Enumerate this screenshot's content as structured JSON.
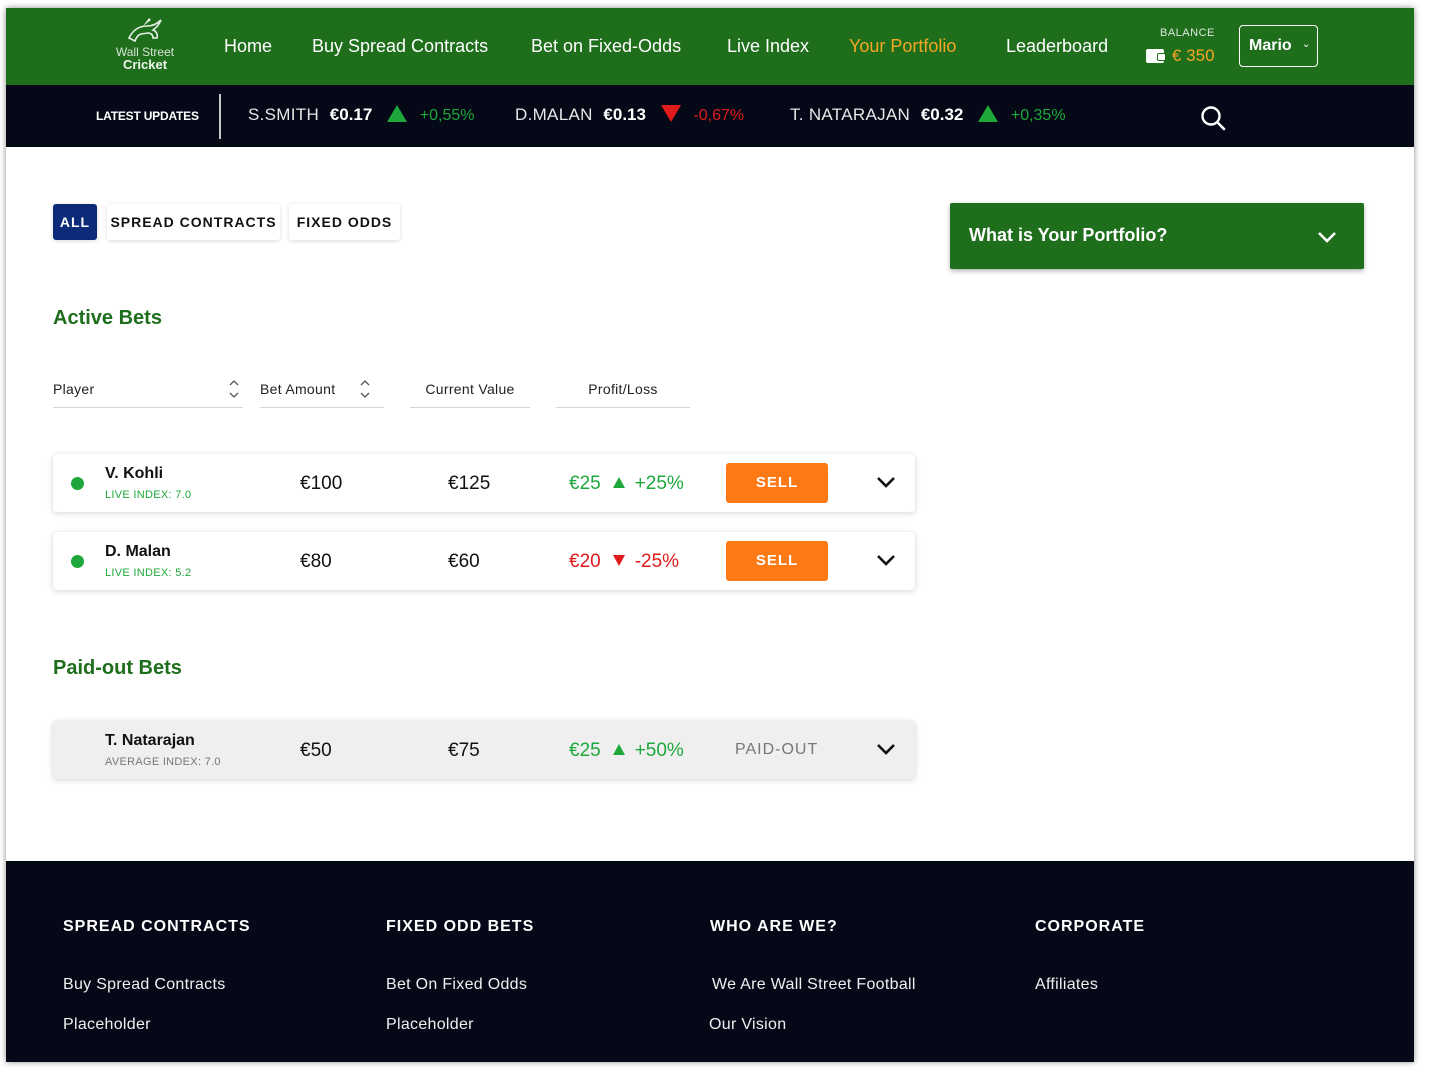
{
  "brand": {
    "line1": "Wall Street",
    "line2": "Cricket"
  },
  "nav": {
    "items": [
      {
        "label": "Home"
      },
      {
        "label": "Buy Spread Contracts"
      },
      {
        "label": "Bet on Fixed-Odds"
      },
      {
        "label": "Live Index"
      },
      {
        "label": "Your Portfolio"
      },
      {
        "label": "Leaderboard"
      }
    ],
    "active_item": "Your Portfolio",
    "balance_label": "BALANCE",
    "balance_value": "€ 350",
    "user_name": "Mario"
  },
  "ticker": {
    "label": "LATEST UPDATES",
    "items": [
      {
        "name": "S.SMITH",
        "price": "€0.17",
        "change": "+0,55%",
        "direction": "up"
      },
      {
        "name": "D.MALAN",
        "price": "€0.13",
        "change": "-0,67%",
        "direction": "down"
      },
      {
        "name": "T. NATARAJAN",
        "price": "€0.32",
        "change": "+0,35%",
        "direction": "up"
      }
    ]
  },
  "filters": {
    "tabs": [
      {
        "label": "ALL"
      },
      {
        "label": "SPREAD CONTRACTS"
      },
      {
        "label": "FIXED ODDS"
      }
    ],
    "active": "ALL"
  },
  "active_bets": {
    "title": "Active Bets",
    "columns": [
      {
        "label": "Player"
      },
      {
        "label": "Bet Amount"
      },
      {
        "label": "Current Value"
      },
      {
        "label": "Profit/Loss"
      }
    ],
    "rows": [
      {
        "player": "V. Kohli",
        "index": "LIVE INDEX: 7.0",
        "amount": "€100",
        "current": "€125",
        "profit": "€25",
        "percent": "+25%",
        "direction": "up",
        "action": "SELL"
      },
      {
        "player": "D. Malan",
        "index": "LIVE INDEX: 5.2",
        "amount": "€80",
        "current": "€60",
        "profit": "€20",
        "percent": "-25%",
        "direction": "down",
        "action": "SELL"
      }
    ]
  },
  "paid_bets": {
    "title": "Paid-out Bets",
    "rows": [
      {
        "player": "T. Natarajan",
        "index": "AVERAGE INDEX: 7.0",
        "amount": "€50",
        "current": "€75",
        "profit": "€25",
        "percent": "+50%",
        "direction": "up",
        "status": "PAID-OUT"
      }
    ]
  },
  "faq": {
    "title": "What is Your Portfolio?"
  },
  "footer": {
    "columns": [
      {
        "heading": "SPREAD CONTRACTS",
        "links": [
          "Buy Spread Contracts",
          "Placeholder"
        ]
      },
      {
        "heading": "FIXED ODD BETS",
        "links": [
          "Bet On Fixed Odds",
          "Placeholder"
        ]
      },
      {
        "heading": "WHO ARE WE?",
        "links": [
          "We Are Wall Street Football",
          "Our Vision"
        ]
      },
      {
        "heading": "CORPORATE",
        "links": [
          "Affiliates"
        ]
      }
    ]
  },
  "colors": {
    "brand_green": "#1e6e1c",
    "navy": "#050816",
    "accent_orange": "#ff7a14",
    "gain": "#1ea83b",
    "loss": "#e01b1b",
    "active_tab": "#0b2a78"
  }
}
